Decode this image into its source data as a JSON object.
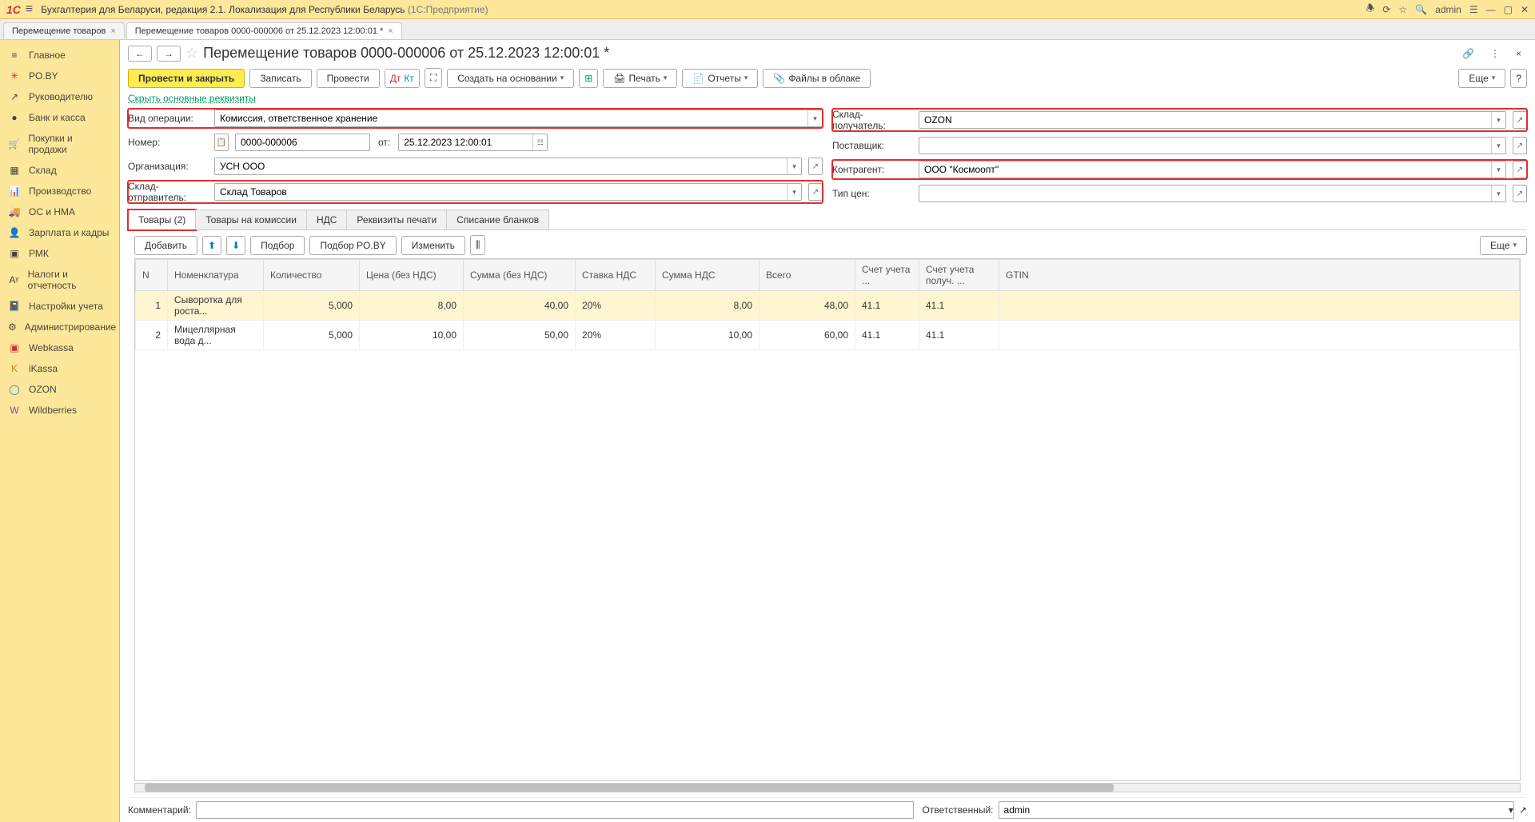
{
  "titlebar": {
    "app_name": "Бухгалтерия для Беларуси, редакция 2.1. Локализация для Республики Беларусь",
    "platform": "(1С:Предприятие)",
    "user": "admin"
  },
  "tabs": [
    {
      "label": "Перемещение товаров",
      "active": false
    },
    {
      "label": "Перемещение товаров 0000-000006 от 25.12.2023 12:00:01 *",
      "active": true
    }
  ],
  "sidebar": {
    "items": [
      {
        "label": "Главное",
        "icon": "≡"
      },
      {
        "label": "PO.BY",
        "icon": "✳"
      },
      {
        "label": "Руководителю",
        "icon": "↗"
      },
      {
        "label": "Банк и касса",
        "icon": "●"
      },
      {
        "label": "Покупки и продажи",
        "icon": "🛒"
      },
      {
        "label": "Склад",
        "icon": "▦"
      },
      {
        "label": "Производство",
        "icon": "📊"
      },
      {
        "label": "ОС и НМА",
        "icon": "🚚"
      },
      {
        "label": "Зарплата и кадры",
        "icon": "👤"
      },
      {
        "label": "РМК",
        "icon": "▣"
      },
      {
        "label": "Налоги и отчетность",
        "icon": "А"
      },
      {
        "label": "Настройки учета",
        "icon": "📓"
      },
      {
        "label": "Администрирование",
        "icon": "⚙"
      },
      {
        "label": "Webkassa",
        "icon": "W"
      },
      {
        "label": "iKassa",
        "icon": "K"
      },
      {
        "label": "OZON",
        "icon": "◯"
      },
      {
        "label": "Wildberries",
        "icon": "W"
      }
    ]
  },
  "doc": {
    "title": "Перемещение товаров 0000-000006 от 25.12.2023 12:00:01 *"
  },
  "toolbar": {
    "post_close": "Провести и закрыть",
    "save": "Записать",
    "post": "Провести",
    "create_based": "Создать на основании",
    "print": "Печать",
    "reports": "Отчеты",
    "files_cloud": "Файлы в облаке",
    "more": "Еще"
  },
  "hide_link": "Скрыть основные реквизиты",
  "form": {
    "left": {
      "op_type_label": "Вид операции:",
      "op_type": "Комиссия, ответственное хранение",
      "number_label": "Номер:",
      "number": "0000-000006",
      "date_label": "от:",
      "date": "25.12.2023 12:00:01",
      "org_label": "Организация:",
      "org": "УСН ООО",
      "from_wh_label": "Склад-отправитель:",
      "from_wh": "Склад Товаров"
    },
    "right": {
      "to_wh_label": "Склад-получатель:",
      "to_wh": "OZON",
      "supplier_label": "Поставщик:",
      "supplier": "",
      "contr_label": "Контрагент:",
      "contr": "ООО \"Космоопт\"",
      "price_type_label": "Тип цен:",
      "price_type": ""
    }
  },
  "doc_tabs": [
    {
      "label": "Товары (2)",
      "active": true,
      "highlight": true
    },
    {
      "label": "Товары на комиссии",
      "active": false
    },
    {
      "label": "НДС",
      "active": false
    },
    {
      "label": "Реквизиты печати",
      "active": false
    },
    {
      "label": "Списание бланков",
      "active": false
    }
  ],
  "table_toolbar": {
    "add": "Добавить",
    "select": "Подбор",
    "select_poby": "Подбор PO.BY",
    "change": "Изменить",
    "more": "Еще"
  },
  "table": {
    "columns": [
      "N",
      "Номенклатура",
      "Количество",
      "Цена (без НДС)",
      "Сумма (без НДС)",
      "Ставка НДС",
      "Сумма НДС",
      "Всего",
      "Счет учета ...",
      "Счет учета получ. ...",
      "GTIN"
    ],
    "rows": [
      {
        "n": "1",
        "nom": "Сыворотка для роста...",
        "qty": "5,000",
        "price": "8,00",
        "sum": "40,00",
        "vat_rate": "20%",
        "vat_sum": "8,00",
        "total": "48,00",
        "acc1": "41.1",
        "acc2": "41.1",
        "gtin": ""
      },
      {
        "n": "2",
        "nom": "Мицеллярная вода д...",
        "qty": "5,000",
        "price": "10,00",
        "sum": "50,00",
        "vat_rate": "20%",
        "vat_sum": "10,00",
        "total": "60,00",
        "acc1": "41.1",
        "acc2": "41.1",
        "gtin": ""
      }
    ]
  },
  "footer": {
    "comment_label": "Комментарий:",
    "comment": "",
    "resp_label": "Ответственный:",
    "resp": "admin"
  }
}
